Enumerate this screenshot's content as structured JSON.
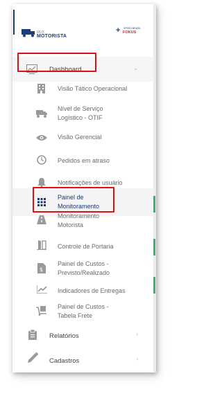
{
  "brand": {
    "logo_small": "MUX",
    "logo_main": "MOTORISTA",
    "partner_top": "SPEED BRASIL",
    "partner_name": "FOKUS"
  },
  "menu": {
    "dashboard": {
      "label": "Dashboard",
      "icon": "chart-line-icon"
    },
    "dashboard_items": [
      {
        "label": "Visão Tático Operacional",
        "icon": "building-icon"
      },
      {
        "label": "Nível de Serviço\nLogístico - OTIF",
        "icon": "truck-icon"
      },
      {
        "label": "Visão Gerencial",
        "icon": "eye-icon"
      },
      {
        "label": "Pedidos em atraso",
        "icon": "clock-icon"
      },
      {
        "label": "Notificações de usuário",
        "icon": "bell-icon"
      },
      {
        "label": "Painel de\nMonitoramento",
        "icon": "grid-icon"
      },
      {
        "label": "Monitoramento\nMotorista",
        "icon": "road-icon"
      },
      {
        "label": "Controle de Portaria",
        "icon": "gate-icon"
      },
      {
        "label": "Painel de Custos -\nPrevisto/Realizado",
        "icon": "document-money-icon"
      },
      {
        "label": "Indicadores de Entregas",
        "icon": "area-chart-icon"
      },
      {
        "label": "Painel de Custos -\nTabela Frete",
        "icon": "hand-truck-icon"
      }
    ],
    "relatorios": {
      "label": "Relatórios",
      "icon": "clipboard-icon"
    },
    "cadastros": {
      "label": "Cadastros",
      "icon": "pencil-icon"
    }
  },
  "chevrons": {
    "down": "⌄",
    "right": "›"
  },
  "colors": {
    "highlight": "#e01010",
    "active_text": "#1e3a78",
    "brand_blue": "#1c3e7f",
    "partner_red": "#d81b2a"
  }
}
